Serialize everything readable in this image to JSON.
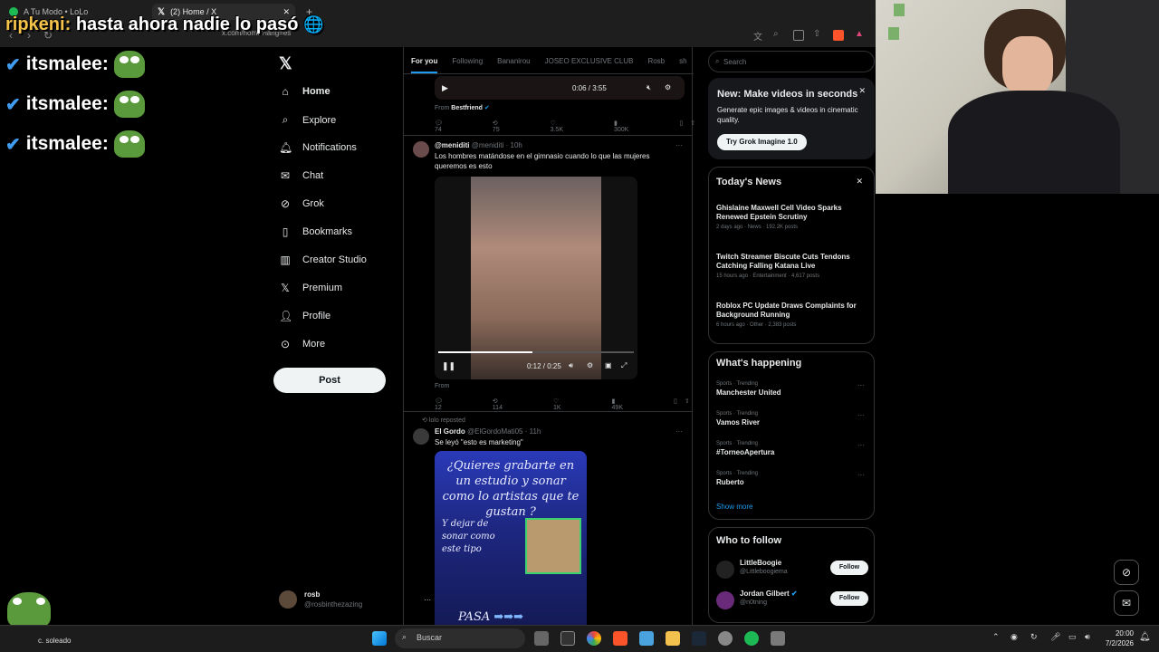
{
  "browser": {
    "tabs": [
      {
        "label": "A Tu Modo • LoLo",
        "active": false
      },
      {
        "label": "(2) Home / X",
        "active": true
      }
    ],
    "address": "x.com/home?lang=es",
    "new_tab": "+"
  },
  "overlay": {
    "user": "ripkeni:",
    "message": "hasta ahora nadie lo pasó",
    "chat": [
      {
        "user": "itsmalee:"
      },
      {
        "user": "itsmalee:"
      },
      {
        "user": "itsmalee:"
      }
    ],
    "emote_count": "x3"
  },
  "x_nav": {
    "items": [
      {
        "label": "Home",
        "icon": "home-icon"
      },
      {
        "label": "Explore",
        "icon": "search-icon"
      },
      {
        "label": "Notifications",
        "icon": "bell-icon"
      },
      {
        "label": "Chat",
        "icon": "mail-icon"
      },
      {
        "label": "Grok",
        "icon": "grok-icon"
      },
      {
        "label": "Bookmarks",
        "icon": "bookmark-icon"
      },
      {
        "label": "Creator Studio",
        "icon": "chart-icon"
      },
      {
        "label": "Premium",
        "icon": "x-icon"
      },
      {
        "label": "Profile",
        "icon": "person-icon"
      },
      {
        "label": "More",
        "icon": "more-icon"
      }
    ],
    "post_label": "Post",
    "account_name": "rosb",
    "account_handle": "@rosbinthezazing"
  },
  "feed": {
    "tabs": [
      "For you",
      "Following",
      "Bananirou",
      "JOSEO EXCLUSIVE CLUB",
      "Rosb",
      "sh"
    ],
    "tweet0": {
      "video_time": "0:06 / 3:55",
      "from_label": "From",
      "from_name": "Bestfriend",
      "replies": "74",
      "reposts": "75",
      "likes": "3.5K",
      "views": "300K"
    },
    "tweet1": {
      "name": "@meniditi",
      "handle": "@meniditi",
      "time": "· 10h",
      "text": "Los hombres matándose en el gimnasio cuando lo que las mujeres queremos es esto",
      "video_time": "0:12 / 0:25",
      "from_label": "From",
      "replies": "12",
      "reposts": "114",
      "likes": "1K",
      "views": "49K"
    },
    "tweet2": {
      "reposted": "lolo reposted",
      "name": "El Gordo",
      "handle": "@ElGordoMati05",
      "time": "· 11h",
      "text": "Se leyó \"esto es marketing\"",
      "image_text_1": "¿Quieres grabarte en un estudio y sonar como lo artistas que te gustan ?",
      "image_text_2": "Y dejar de sonar como este tipo",
      "image_text_3": "PASA"
    }
  },
  "sidebar": {
    "search_placeholder": "Search",
    "promo": {
      "title": "New: Make videos in seconds",
      "body": "Generate epic images & videos in cinematic quality.",
      "button": "Try Grok Imagine 1.0"
    },
    "news_title": "Today's News",
    "news": [
      {
        "title": "Ghislaine Maxwell Cell Video Sparks Renewed Epstein Scrutiny",
        "meta": "2 days ago · News · 192.2K posts"
      },
      {
        "title": "Twitch Streamer Biscute Cuts Tendons Catching Falling Katana Live",
        "meta": "15 hours ago · Entertainment · 4,617 posts"
      },
      {
        "title": "Roblox PC Update Draws Complaints for Background Running",
        "meta": "6 hours ago · Other · 2,383 posts"
      }
    ],
    "happening_title": "What's happening",
    "trends": [
      {
        "cat": "Sports · Trending",
        "name": "Manchester United"
      },
      {
        "cat": "Sports · Trending",
        "name": "Vamos River"
      },
      {
        "cat": "Sports · Trending",
        "name": "#TorneoApertura"
      },
      {
        "cat": "Sports · Trending",
        "name": "Ruberto"
      }
    ],
    "show_more": "Show more",
    "follow_title": "Who to follow",
    "follow": [
      {
        "name": "LittleBoogie",
        "handle": "@Littleboogiema",
        "button": "Follow"
      },
      {
        "name": "Jordan Gilbert",
        "handle": "@n0tning",
        "button": "Follow"
      }
    ]
  },
  "taskbar": {
    "search": "Buscar",
    "weather": "c. soleado",
    "time": "20:00",
    "date": "7/2/2026"
  },
  "colors": {
    "accent": "#1d9bf0",
    "bg": "#000000",
    "border": "#2f3336"
  }
}
